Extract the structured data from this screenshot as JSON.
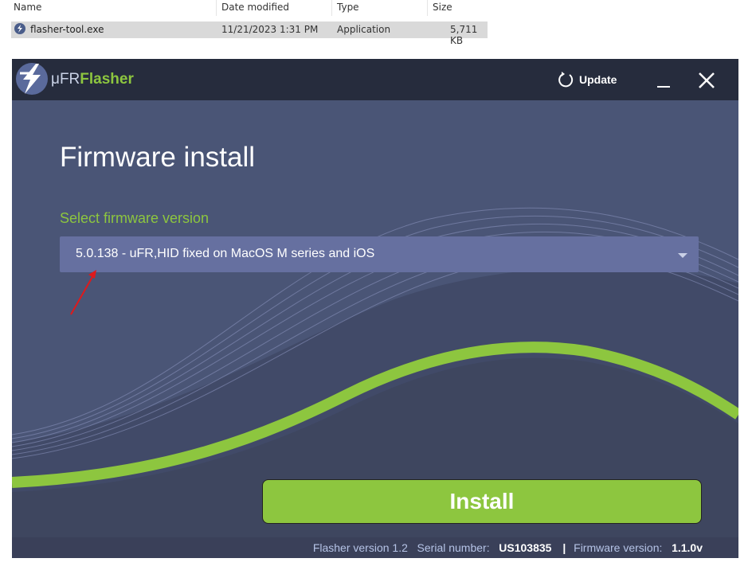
{
  "explorer": {
    "columns": {
      "name": "Name",
      "date_modified": "Date modified",
      "type": "Type",
      "size": "Size"
    },
    "file": {
      "name": "flasher-tool.exe",
      "date_modified": "11/21/2023 1:31 PM",
      "type": "Application",
      "size": "5,711 KB"
    }
  },
  "app": {
    "brand_prefix": "μFR",
    "brand_accent": "Flasher",
    "update_label": "Update",
    "page_title": "Firmware install",
    "select_label": "Select firmware version",
    "selected_firmware": "5.0.138 - uFR,HID fixed on MacOS M series and iOS",
    "install_label": "Install",
    "status": {
      "flasher_version_label": "Flasher version 1.2",
      "serial_label": "Serial number:",
      "serial_value": "US103835",
      "separator": "|",
      "firmware_label": "Firmware version:",
      "firmware_value": "1.1.0v"
    }
  },
  "colors": {
    "accent_green": "#8dc63f",
    "titlebar": "#262c3d",
    "background": "#4a5576",
    "dropdown": "#6670a0"
  }
}
